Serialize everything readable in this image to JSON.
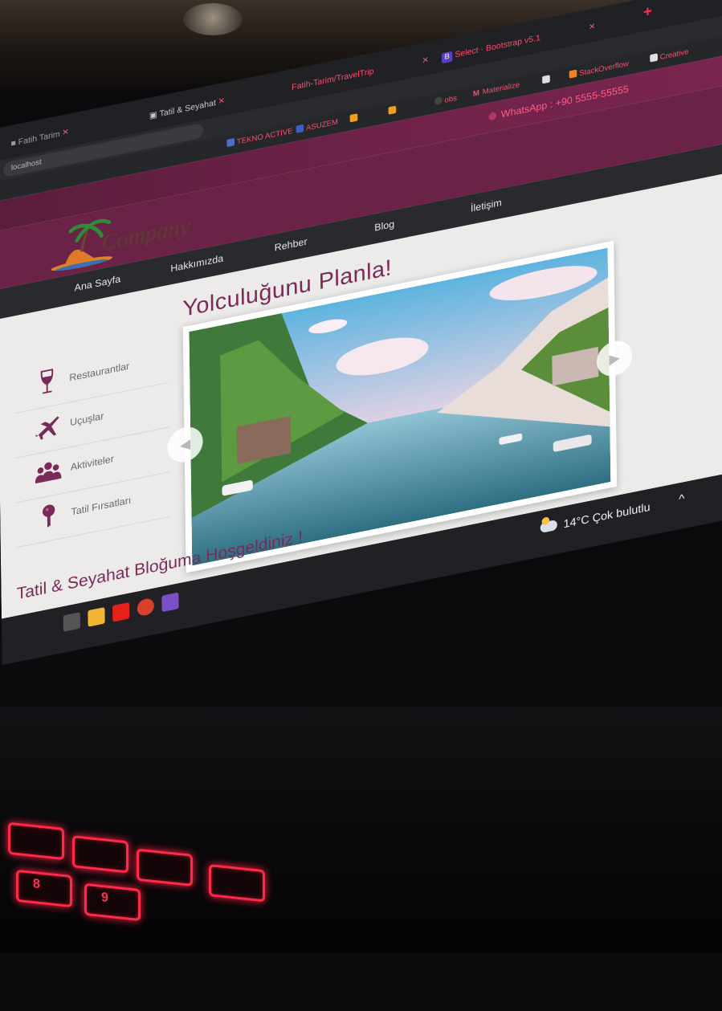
{
  "browser": {
    "tabs": [
      {
        "label": "Fatih-Tarim/TravelTrip",
        "close": "×"
      },
      {
        "label": "Select · Bootstrap v5.1",
        "favicon": "B",
        "close": "×"
      },
      {
        "new_tab": "+"
      }
    ],
    "bookmarks": [
      {
        "label": "obs"
      },
      {
        "label": "Materialize",
        "favicon": "M"
      },
      {
        "label": "StackOverflow"
      },
      {
        "label": "Creative"
      },
      {
        "label": "TEKNO ACTIVE"
      },
      {
        "label": "ASUZEM"
      }
    ],
    "address": "localhost"
  },
  "site": {
    "whatsapp": "WhatsApp : +90 5555-55555",
    "logo_text": "Company",
    "nav": [
      "Ana Sayfa",
      "Hakkımızda",
      "Rehber",
      "Blog",
      "İletişim"
    ],
    "plan_title": "Yolculuğunu Planla!",
    "sidebar": [
      {
        "label": "Restaurantlar",
        "icon": "wine-glass-icon"
      },
      {
        "label": "Uçuşlar",
        "icon": "airplane-icon"
      },
      {
        "label": "Aktiviteler",
        "icon": "people-icon"
      },
      {
        "label": "Tatil Fırsatları",
        "icon": "map-pin-icon"
      }
    ],
    "carousel": {
      "prev": "◀",
      "next": "▶"
    },
    "welcome": "Tatil & Seyahat Bloğuma Hoşgeldiniz !"
  },
  "taskbar": {
    "weather_temp": "14°C",
    "weather_desc": "Çok bulutlu",
    "chevron": "^"
  },
  "keyboard": {
    "keys": [
      "8",
      "9"
    ]
  },
  "colors": {
    "brand": "#6a2346",
    "accent": "#ff4d6d",
    "title": "#7a2a58",
    "keyboard_glow": "#ff2a4a"
  }
}
